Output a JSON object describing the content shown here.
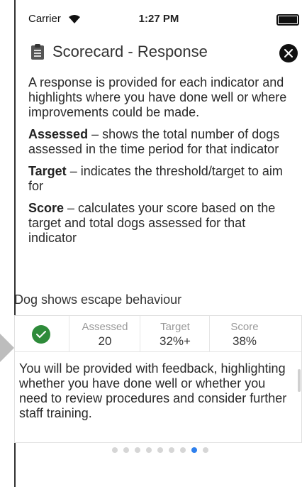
{
  "status_bar": {
    "carrier": "Carrier",
    "time": "1:27 PM"
  },
  "header": {
    "title": "Scorecard - Response",
    "icon": "clipboard-icon"
  },
  "intro": {
    "p1": "A response is provided for each indicator and highlights where you have done well or where improvements could be made.",
    "assessed_term": "Assessed",
    "assessed_desc": " – shows the total number of dogs assessed in the time period for that indicator",
    "target_term": "Target",
    "target_desc": " – indicates the threshold/target to aim for",
    "score_term": "Score",
    "score_desc": " – calculates your score based on the target and total dogs assessed for that indicator"
  },
  "indicator": {
    "title": "Dog shows escape behaviour",
    "assessed_label": "Assessed",
    "assessed_value": "20",
    "target_label": "Target",
    "target_value": "32%+",
    "score_label": "Score",
    "score_value": "38%",
    "feedback": "You will be provided with feedback, highlighting whether you have done well or whether you need to review procedures and consider further staff training."
  },
  "pagination": {
    "total": 9,
    "active_index": 7
  },
  "colors": {
    "accent": "#2f80ed",
    "success": "#2e8b3a"
  }
}
